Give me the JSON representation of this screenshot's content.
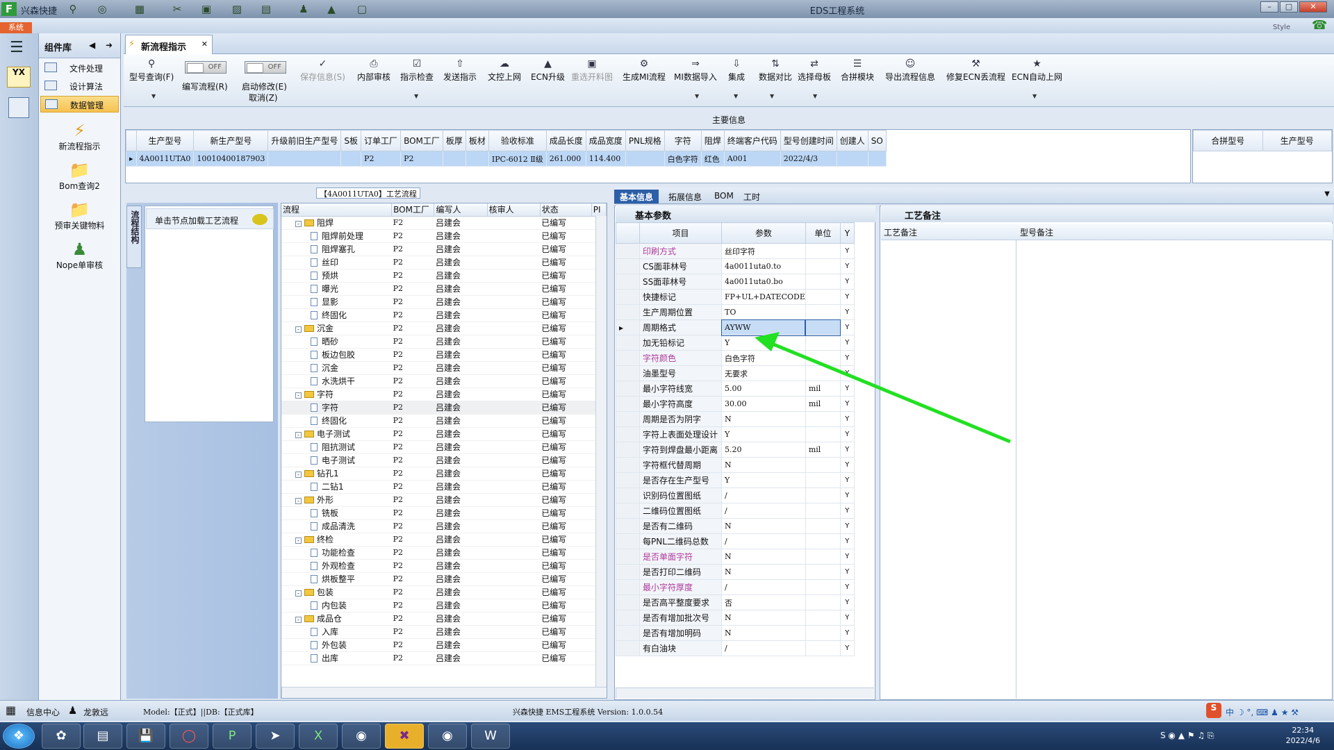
{
  "window": {
    "app_name": "兴森快捷",
    "title": "EDS工程系统",
    "style_label": "Style"
  },
  "menu": {
    "system_tab": "系统"
  },
  "component_library": {
    "title": "组件库",
    "items": [
      {
        "label": "文件处理"
      },
      {
        "label": "设计算法"
      },
      {
        "label": "数据管理",
        "selected": true
      }
    ],
    "tools": [
      {
        "label": "新流程指示",
        "icon": "lightning-icon"
      },
      {
        "label": "Bom查询2",
        "icon": "folder-icon"
      },
      {
        "label": "预审关键物料",
        "icon": "folder-icon"
      },
      {
        "label": "Nope单审核",
        "icon": "user-icon"
      }
    ]
  },
  "doc_tab": {
    "label": "新流程指示"
  },
  "ribbon": {
    "buttons": [
      {
        "label": "型号查询(F)",
        "icon": "search-icon",
        "dropdown": true
      },
      {
        "label": "保存信息(S)",
        "icon": "check-icon",
        "disabled": true
      },
      {
        "label": "内部审核",
        "icon": "print-icon"
      },
      {
        "label": "指示检查",
        "icon": "check-icon",
        "dropdown": true
      },
      {
        "label": "发送指示",
        "icon": "upload-icon"
      },
      {
        "label": "文控上网",
        "icon": "cloud-icon"
      },
      {
        "label": "ECN升级",
        "icon": "upgrade-icon"
      },
      {
        "label": "重选开料图",
        "icon": "image-icon",
        "disabled": true
      },
      {
        "label": "生成MI流程",
        "icon": "gear-icon"
      },
      {
        "label": "MI数据导入",
        "icon": "import-icon",
        "dropdown": true
      },
      {
        "label": "集成",
        "icon": "download-icon",
        "dropdown": true
      },
      {
        "label": "数据对比",
        "icon": "compare-icon",
        "dropdown": true
      },
      {
        "label": "选择母板",
        "icon": "shuffle-icon",
        "dropdown": true
      },
      {
        "label": "合拼模块",
        "icon": "list-icon"
      },
      {
        "label": "导出流程信息",
        "icon": "export-icon"
      },
      {
        "label": "修复ECN丢流程",
        "icon": "wrench-icon"
      },
      {
        "label": "ECN自动上网",
        "icon": "star-icon",
        "dropdown": true
      }
    ],
    "toggles": [
      {
        "label": "编写流程(R)",
        "state": "OFF"
      },
      {
        "label": "启动修改(E)",
        "state": "OFF",
        "sub_label": "取消(Z)"
      }
    ]
  },
  "main_info": {
    "title": "主要信息",
    "columns": [
      "生产型号",
      "新生产型号",
      "升级前旧生产型号",
      "S板",
      "订单工厂",
      "BOM工厂",
      "板厚",
      "板材",
      "验收标准",
      "成品长度",
      "成品宽度",
      "PNL规格",
      "字符",
      "阻焊",
      "终端客户代码",
      "型号创建时间",
      "创建人",
      "SO"
    ],
    "rows": [
      [
        "4A0011UTA0",
        "10010400187903",
        "",
        "",
        "P2",
        "P2",
        "",
        "",
        "IPC-6012 Ⅱ级",
        "261.000",
        "114.400",
        "",
        "白色字符",
        "红色",
        "A001",
        "2022/4/3",
        "",
        ""
      ]
    ],
    "side_columns": [
      "合拼型号",
      "生产型号"
    ]
  },
  "process_flow": {
    "title": "【4A0011UTA0】工艺流程",
    "nav_tab": "流程结构",
    "nav_button": "单击节点加载工艺流程",
    "columns": [
      "流程",
      "BOM工厂",
      "编写人",
      "核审人",
      "状态",
      "PI"
    ],
    "rows": [
      {
        "name": "阻焊",
        "level": 0,
        "factory": "F2",
        "writer": "吕建会",
        "status": "已编写",
        "cut": true
      },
      {
        "name": "阻焊前处理",
        "level": 1,
        "factory": "P2",
        "writer": "吕建会",
        "status": "已编写"
      },
      {
        "name": "阻焊塞孔",
        "level": 1,
        "factory": "P2",
        "writer": "吕建会",
        "status": "已编写"
      },
      {
        "name": "丝印",
        "level": 1,
        "factory": "P2",
        "writer": "吕建会",
        "status": "已编写"
      },
      {
        "name": "预烘",
        "level": 1,
        "factory": "P2",
        "writer": "吕建会",
        "status": "已编写"
      },
      {
        "name": "曝光",
        "level": 1,
        "factory": "P2",
        "writer": "吕建会",
        "status": "已编写"
      },
      {
        "name": "显影",
        "level": 1,
        "factory": "P2",
        "writer": "吕建会",
        "status": "已编写"
      },
      {
        "name": "终固化",
        "level": 1,
        "factory": "P2",
        "writer": "吕建会",
        "status": "已编写"
      },
      {
        "name": "沉金",
        "level": 0,
        "factory": "P2",
        "writer": "吕建会",
        "status": "已编写"
      },
      {
        "name": "晒砂",
        "level": 1,
        "factory": "P2",
        "writer": "吕建会",
        "status": "已编写"
      },
      {
        "name": "板边包胶",
        "level": 1,
        "factory": "P2",
        "writer": "吕建会",
        "status": "已编写"
      },
      {
        "name": "沉金",
        "level": 1,
        "factory": "P2",
        "writer": "吕建会",
        "status": "已编写"
      },
      {
        "name": "水洗烘干",
        "level": 1,
        "factory": "P2",
        "writer": "吕建会",
        "status": "已编写"
      },
      {
        "name": "字符",
        "level": 0,
        "factory": "P2",
        "writer": "吕建会",
        "status": "已编写"
      },
      {
        "name": "字符",
        "level": 1,
        "factory": "P2",
        "writer": "吕建会",
        "status": "已编写",
        "highlight": true
      },
      {
        "name": "终固化",
        "level": 1,
        "factory": "P2",
        "writer": "吕建会",
        "status": "已编写"
      },
      {
        "name": "电子测试",
        "level": 0,
        "factory": "P2",
        "writer": "吕建会",
        "status": "已编写"
      },
      {
        "name": "阻抗测试",
        "level": 1,
        "factory": "P2",
        "writer": "吕建会",
        "status": "已编写"
      },
      {
        "name": "电子测试",
        "level": 1,
        "factory": "P2",
        "writer": "吕建会",
        "status": "已编写"
      },
      {
        "name": "钻孔1",
        "level": 0,
        "factory": "P2",
        "writer": "吕建会",
        "status": "已编写"
      },
      {
        "name": "二钻1",
        "level": 1,
        "factory": "P2",
        "writer": "吕建会",
        "status": "已编写"
      },
      {
        "name": "外形",
        "level": 0,
        "factory": "P2",
        "writer": "吕建会",
        "status": "已编写"
      },
      {
        "name": "铣板",
        "level": 1,
        "factory": "P2",
        "writer": "吕建会",
        "status": "已编写"
      },
      {
        "name": "成品清洗",
        "level": 1,
        "factory": "P2",
        "writer": "吕建会",
        "status": "已编写"
      },
      {
        "name": "终检",
        "level": 0,
        "factory": "P2",
        "writer": "吕建会",
        "status": "已编写"
      },
      {
        "name": "功能检查",
        "level": 1,
        "factory": "P2",
        "writer": "吕建会",
        "status": "已编写"
      },
      {
        "name": "外观检查",
        "level": 1,
        "factory": "P2",
        "writer": "吕建会",
        "status": "已编写"
      },
      {
        "name": "烘板整平",
        "level": 1,
        "factory": "P2",
        "writer": "吕建会",
        "status": "已编写"
      },
      {
        "name": "包装",
        "level": 0,
        "factory": "P2",
        "writer": "吕建会",
        "status": "已编写"
      },
      {
        "name": "内包装",
        "level": 1,
        "factory": "P2",
        "writer": "吕建会",
        "status": "已编写"
      },
      {
        "name": "成品仓",
        "level": 0,
        "factory": "P2",
        "writer": "吕建会",
        "status": "已编写"
      },
      {
        "name": "入库",
        "level": 1,
        "factory": "P2",
        "writer": "吕建会",
        "status": "已编写"
      },
      {
        "name": "外包装",
        "level": 1,
        "factory": "P2",
        "writer": "吕建会",
        "status": "已编写"
      },
      {
        "name": "出库",
        "level": 1,
        "factory": "P2",
        "writer": "吕建会",
        "status": "已编写"
      }
    ]
  },
  "right_tabs": [
    "基本信息",
    "拓展信息",
    "BOM",
    "工时"
  ],
  "basic_params": {
    "title": "基本参数",
    "columns": [
      "项目",
      "参数",
      "单位",
      "Y"
    ],
    "rows": [
      {
        "item": "印刷方式",
        "value": "丝印字符",
        "unit": "",
        "flag": "Y",
        "pink": true
      },
      {
        "item": "CS面菲林号",
        "value": "4a0011uta0.to",
        "unit": "",
        "flag": "Y"
      },
      {
        "item": "SS面菲林号",
        "value": "4a0011uta0.bo",
        "unit": "",
        "flag": "Y"
      },
      {
        "item": "快捷标记",
        "value": "FP+UL+DATECODE",
        "unit": "",
        "flag": "Y"
      },
      {
        "item": "生产周期位置",
        "value": "TO",
        "unit": "",
        "flag": "Y"
      },
      {
        "item": "周期格式",
        "value": "AYWW",
        "unit": "",
        "flag": "Y",
        "current": true
      },
      {
        "item": "加无铅标记",
        "value": "Y",
        "unit": "",
        "flag": "Y"
      },
      {
        "item": "字符颜色",
        "value": "白色字符",
        "unit": "",
        "flag": "Y",
        "pink": true
      },
      {
        "item": "油墨型号",
        "value": "无要求",
        "unit": "",
        "flag": "Y"
      },
      {
        "item": "最小字符线宽",
        "value": "5.00",
        "unit": "mil",
        "flag": "Y"
      },
      {
        "item": "最小字符高度",
        "value": "30.00",
        "unit": "mil",
        "flag": "Y"
      },
      {
        "item": "周期是否为阴字",
        "value": "N",
        "unit": "",
        "flag": "Y"
      },
      {
        "item": "字符上表面处理设计",
        "value": "Y",
        "unit": "",
        "flag": "Y"
      },
      {
        "item": "字符到焊盘最小距离",
        "value": "5.20",
        "unit": "mil",
        "flag": "Y"
      },
      {
        "item": "字符框代替周期",
        "value": "N",
        "unit": "",
        "flag": "Y"
      },
      {
        "item": "是否存在生产型号",
        "value": "Y",
        "unit": "",
        "flag": "Y"
      },
      {
        "item": "识别码位置图纸",
        "value": "/",
        "unit": "",
        "flag": "Y"
      },
      {
        "item": "二维码位置图纸",
        "value": "/",
        "unit": "",
        "flag": "Y"
      },
      {
        "item": "是否有二维码",
        "value": "N",
        "unit": "",
        "flag": "Y"
      },
      {
        "item": "每PNL二维码总数",
        "value": "/",
        "unit": "",
        "flag": "Y"
      },
      {
        "item": "是否单面字符",
        "value": "N",
        "unit": "",
        "flag": "Y",
        "pink": true
      },
      {
        "item": "是否打印二维码",
        "value": "N",
        "unit": "",
        "flag": "Y"
      },
      {
        "item": "最小字符厚度",
        "value": "/",
        "unit": "",
        "flag": "Y",
        "pink": true
      },
      {
        "item": "是否高平整度要求",
        "value": "否",
        "unit": "",
        "flag": "Y"
      },
      {
        "item": "是否有增加批次号",
        "value": "N",
        "unit": "",
        "flag": "Y"
      },
      {
        "item": "是否有增加明码",
        "value": "N",
        "unit": "",
        "flag": "Y"
      },
      {
        "item": "有白油块",
        "value": "/",
        "unit": "",
        "flag": "Y"
      }
    ]
  },
  "notes": {
    "title": "工艺备注",
    "col1": "工艺备注",
    "col2": "型号备注"
  },
  "status": {
    "info_center": "信息中心",
    "user": "龙敦远",
    "model": "Model:【正式】||DB:【正式库】",
    "system": "兴森快捷 EMS工程系统 Version: 1.0.0.54"
  },
  "taskbar": {
    "time": "22:34",
    "date": "2022/4/6"
  },
  "colors": {
    "arrow": "#22e022",
    "accent": "#2c5fa8"
  }
}
